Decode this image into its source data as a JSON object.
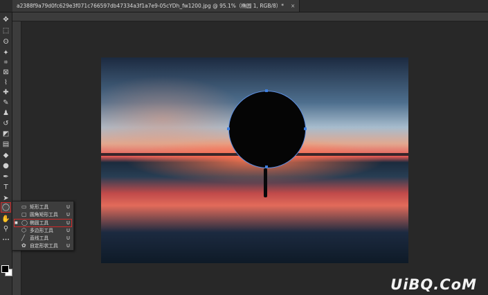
{
  "document_tab": {
    "title": "a2388f9a79d0fc629e3f071c766597db47334a3f1a7e9-05cYDh_fw1200.jpg @ 95.1%（椭圆 1, RGB/8）*",
    "close": "×"
  },
  "toolbar": {
    "tools": [
      {
        "name": "move-tool",
        "glyph": "✥"
      },
      {
        "name": "marquee-tool",
        "glyph": "⬚"
      },
      {
        "name": "lasso-tool",
        "glyph": "ʘ"
      },
      {
        "name": "magic-wand-tool",
        "glyph": "✦"
      },
      {
        "name": "crop-tool",
        "glyph": "⌗"
      },
      {
        "name": "frame-tool",
        "glyph": "⊠"
      },
      {
        "name": "eyedropper-tool",
        "glyph": "⌇"
      },
      {
        "name": "healing-brush-tool",
        "glyph": "✚"
      },
      {
        "name": "brush-tool",
        "glyph": "✎"
      },
      {
        "name": "clone-stamp-tool",
        "glyph": "♟"
      },
      {
        "name": "history-brush-tool",
        "glyph": "↺"
      },
      {
        "name": "eraser-tool",
        "glyph": "◩"
      },
      {
        "name": "gradient-tool",
        "glyph": "▤"
      },
      {
        "name": "blur-tool",
        "glyph": "◆"
      },
      {
        "name": "dodge-tool",
        "glyph": "●"
      },
      {
        "name": "pen-tool",
        "glyph": "✒"
      },
      {
        "name": "type-tool",
        "glyph": "T"
      },
      {
        "name": "path-selection-tool",
        "glyph": "➤"
      },
      {
        "name": "ellipse-tool",
        "glyph": "◯"
      },
      {
        "name": "hand-tool",
        "glyph": "✋"
      },
      {
        "name": "zoom-tool",
        "glyph": "⚲"
      },
      {
        "name": "more-tools",
        "glyph": "•••"
      }
    ]
  },
  "shape_flyout": {
    "items": [
      {
        "name": "rectangle-tool",
        "icon": "▭",
        "label": "矩形工具",
        "key": "U"
      },
      {
        "name": "rounded-rectangle-tool",
        "icon": "▢",
        "label": "圆角矩形工具",
        "key": "U"
      },
      {
        "name": "ellipse-tool",
        "icon": "◯",
        "label": "椭圆工具",
        "key": "U",
        "mark": "■"
      },
      {
        "name": "polygon-tool",
        "icon": "⬡",
        "label": "多边形工具",
        "key": "U"
      },
      {
        "name": "line-tool",
        "icon": "╱",
        "label": "直线工具",
        "key": "U"
      },
      {
        "name": "custom-shape-tool",
        "icon": "✿",
        "label": "自定形状工具",
        "key": "U"
      }
    ]
  },
  "watermark": "UiBQ.CoM",
  "colors": {
    "accent": "#3e7ee0",
    "highlight": "#d02a2a"
  }
}
